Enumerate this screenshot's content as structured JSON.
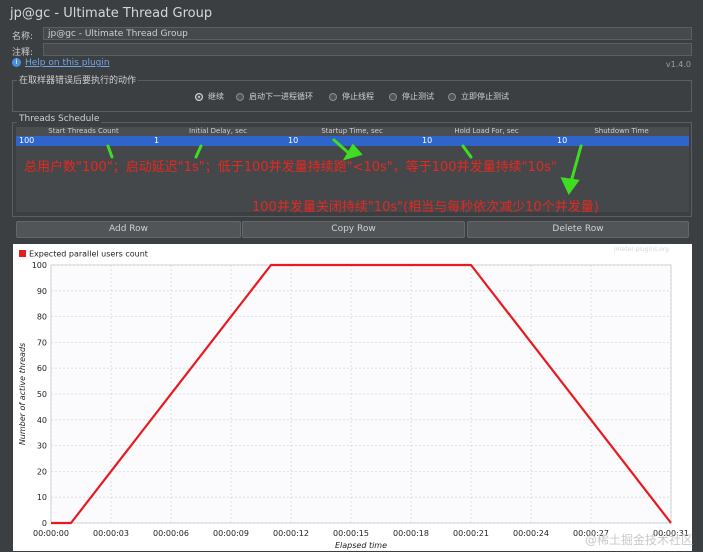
{
  "window": {
    "title": "jp@gc - Ultimate Thread Group"
  },
  "form": {
    "name_label": "名称:",
    "name_value": "jp@gc - Ultimate Thread Group",
    "comment_label": "注释:",
    "comment_value": "",
    "help_link": "Help on this plugin",
    "version": "v1.4.0"
  },
  "error_action": {
    "title": "在取样器错误后要执行的动作",
    "options": [
      {
        "label": "继续",
        "selected": true
      },
      {
        "label": "启动下一进程循环",
        "selected": false
      },
      {
        "label": "停止线程",
        "selected": false
      },
      {
        "label": "停止测试",
        "selected": false
      },
      {
        "label": "立即停止测试",
        "selected": false
      }
    ]
  },
  "schedule": {
    "title": "Threads Schedule",
    "columns": [
      "Start Threads Count",
      "Initial Delay, sec",
      "Startup Time, sec",
      "Hold Load For, sec",
      "Shutdown Time"
    ],
    "rows": [
      [
        "100",
        "1",
        "10",
        "10",
        "10"
      ]
    ]
  },
  "buttons": {
    "add_row": "Add Row",
    "copy_row": "Copy Row",
    "delete_row": "Delete Row"
  },
  "annotations": {
    "line1": "总用户数\"100\"；启动延迟\"1s\"；低于100并发量持续跑\"<10s\"，等于100并发量持续\"10s\"",
    "line2": "100并发量关闭持续\"10s\"(相当与每秒依次减少10个并发量)"
  },
  "chart_data": {
    "type": "line",
    "legend": "Expected parallel users count",
    "legend_position": "top-left",
    "xlabel": "Elapsed time",
    "ylabel": "Number of active threads",
    "xlim": [
      0,
      31
    ],
    "ylim": [
      0,
      100
    ],
    "x_ticks": [
      "00:00:00",
      "00:00:03",
      "00:00:06",
      "00:00:09",
      "00:00:12",
      "00:00:15",
      "00:00:18",
      "00:00:21",
      "00:00:24",
      "00:00:27",
      "00:00:31"
    ],
    "x_tick_seconds": [
      0,
      3,
      6,
      9,
      12,
      15,
      18,
      21,
      24,
      27,
      31
    ],
    "y_ticks": [
      0,
      10,
      20,
      30,
      40,
      50,
      60,
      70,
      80,
      90,
      100
    ],
    "grid": true,
    "series": [
      {
        "name": "Expected parallel users count",
        "color": "#e8191f",
        "x": [
          0,
          1,
          11,
          21,
          31
        ],
        "y": [
          0,
          0,
          100,
          100,
          0
        ]
      }
    ],
    "watermark": "jmeter-plugins.org"
  },
  "site_watermark": "@稀土掘金技术社区",
  "colors": {
    "panel": "#3b3f42",
    "selection": "#2f65ca",
    "annotation": "#e8271f",
    "arrow": "#3fdc22",
    "line": "#e8191f"
  }
}
